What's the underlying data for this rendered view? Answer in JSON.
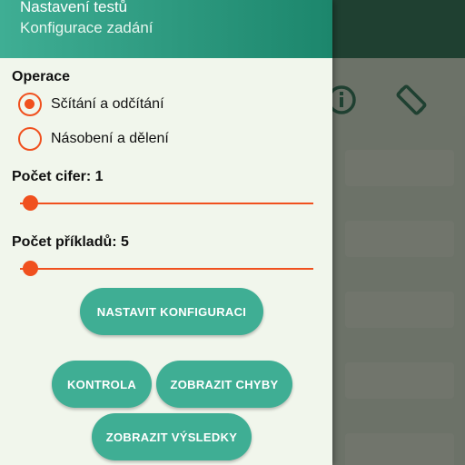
{
  "drawer": {
    "title": "Nastavení testů",
    "subtitle": "Konfigurace zadání"
  },
  "operations": {
    "label": "Operace",
    "options": [
      {
        "label": "Sčítání a odčítání",
        "selected": true
      },
      {
        "label": "Násobení a dělení",
        "selected": false
      }
    ]
  },
  "digits": {
    "label": "Počet cifer: 1",
    "value": 1
  },
  "examples": {
    "label": "Počet příkladů: 5",
    "value": 5
  },
  "buttons": {
    "set_config": "NASTAVIT KONFIGURACI",
    "check": "KONTROLA",
    "show_errors": "ZOBRAZIT CHYBY",
    "show_results": "ZOBRAZIT VÝSLEDKY"
  },
  "background_app": {
    "icons": [
      "info-icon",
      "screen-rotation-icon"
    ]
  },
  "colors": {
    "accent": "#f0501e",
    "button": "#3fae94",
    "header": "#2e9a80",
    "drawer_bg": "#f1f6ec"
  }
}
